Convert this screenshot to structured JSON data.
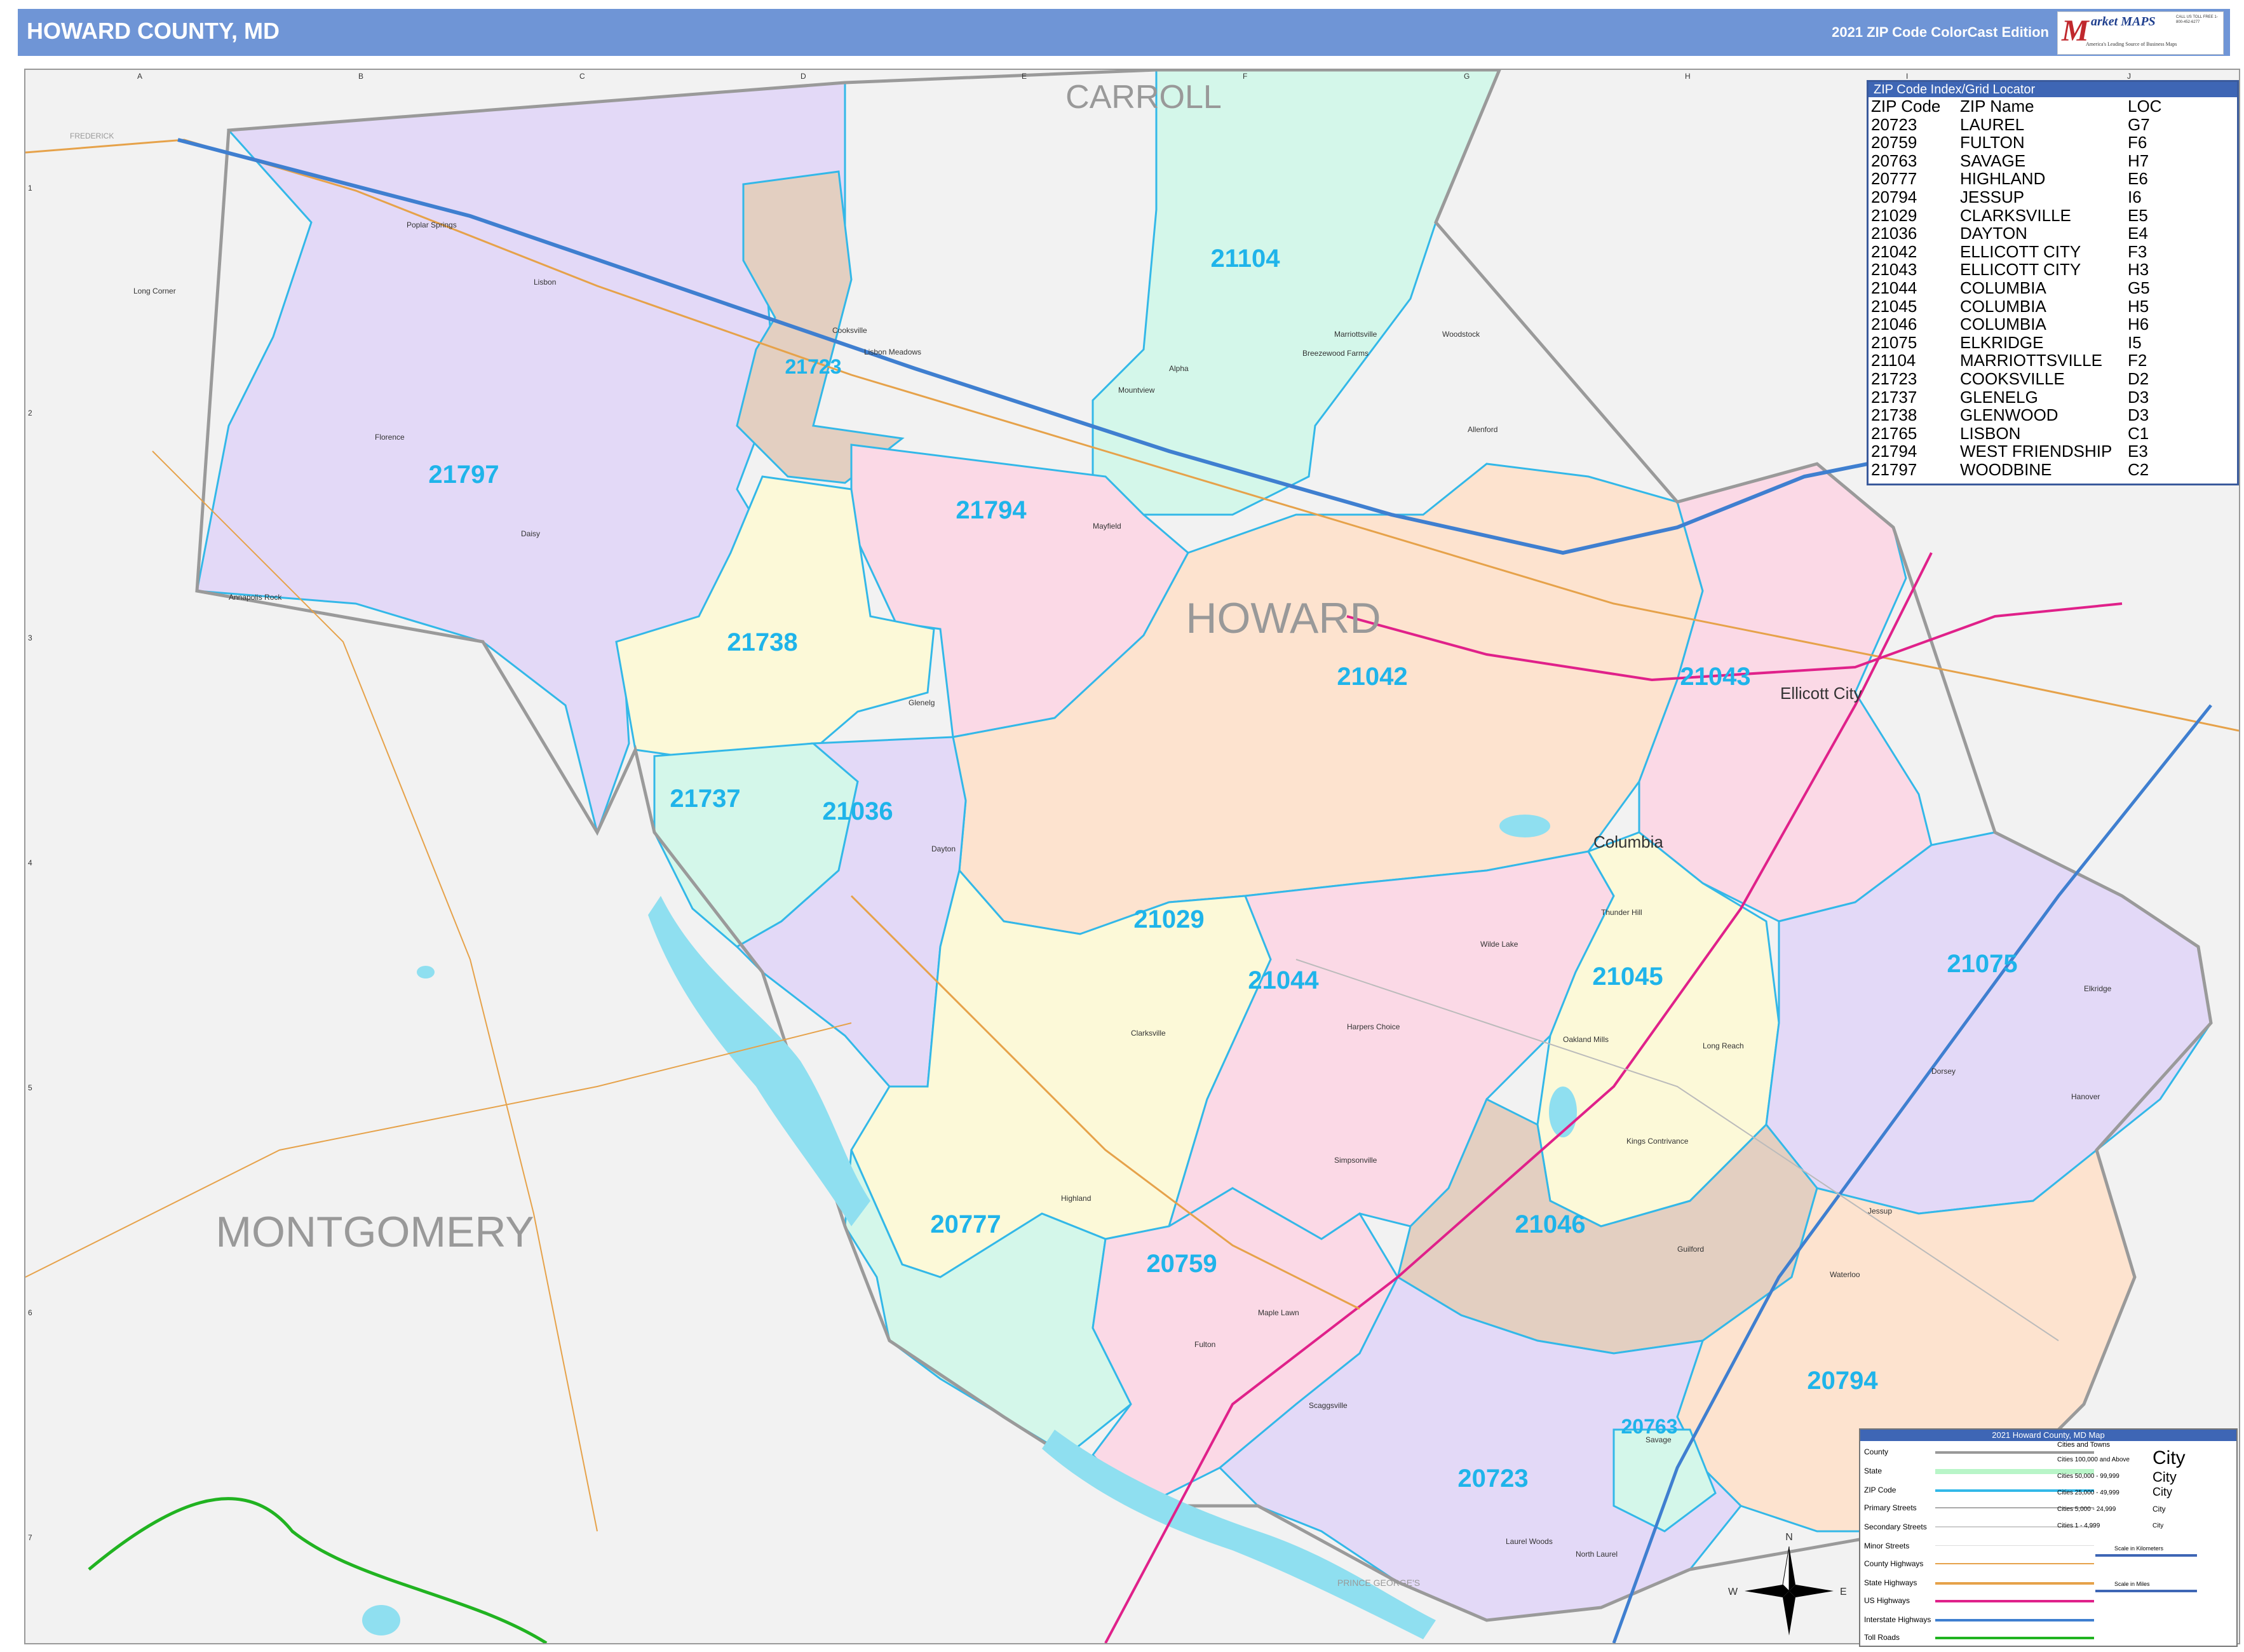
{
  "header": {
    "title": "HOWARD COUNTY, MD",
    "edition": "2021 ZIP Code ColorCast Edition",
    "logo_m": "M",
    "logo_name": "arket MAPS",
    "logo_tagline": "America's Leading Source of Business Maps",
    "logo_contact": "CALL US TOLL FREE 1-800-452-6277"
  },
  "counties": {
    "carroll": "CARROLL",
    "howard": "HOWARD",
    "montgomery": "MONTGOMERY",
    "prince_georges": "PRINCE GEORGE'S",
    "frederick": "FREDERICK"
  },
  "cities": {
    "ellicott_city": "Ellicott City",
    "columbia": "Columbia"
  },
  "zip_labels": [
    "21104",
    "21723",
    "21797",
    "21794",
    "21738",
    "21042",
    "21043",
    "21737",
    "21036",
    "21029",
    "21044",
    "21045",
    "21075",
    "21046",
    "20777",
    "20759",
    "20794",
    "20763",
    "20723"
  ],
  "places": [
    "Poplar Springs",
    "Lisbon",
    "Long Corner",
    "Florence",
    "Daisy",
    "Annapolis Rock",
    "Cooksville",
    "Lisbon Meadows",
    "Alpha",
    "Mountview",
    "Marriottsville",
    "Woodstock",
    "Breezewood Farms",
    "Allenford",
    "Glenelg",
    "Dayton",
    "Clarksville",
    "Highland",
    "Fulton",
    "Scaggsville",
    "Savage",
    "Jessup",
    "Elkridge",
    "Dorsey",
    "Mayfield",
    "Guilford",
    "Simpsonville",
    "Waterloo",
    "Hanover",
    "North Laurel",
    "Laurel Woods",
    "Kings Contrivance",
    "Oakland Mills",
    "Harpers Choice",
    "Wilde Lake",
    "Long Reach",
    "Thunder Hill",
    "Maple Lawn"
  ],
  "index": {
    "title": "ZIP Code Index/Grid Locator",
    "headers": [
      "ZIP Code",
      "ZIP Name",
      "LOC"
    ],
    "rows": [
      [
        "20723",
        "LAUREL",
        "G7"
      ],
      [
        "20759",
        "FULTON",
        "F6"
      ],
      [
        "20763",
        "SAVAGE",
        "H7"
      ],
      [
        "20777",
        "HIGHLAND",
        "E6"
      ],
      [
        "20794",
        "JESSUP",
        "I6"
      ],
      [
        "21029",
        "CLARKSVILLE",
        "E5"
      ],
      [
        "21036",
        "DAYTON",
        "E4"
      ],
      [
        "21042",
        "ELLICOTT CITY",
        "F3"
      ],
      [
        "21043",
        "ELLICOTT CITY",
        "H3"
      ],
      [
        "21044",
        "COLUMBIA",
        "G5"
      ],
      [
        "21045",
        "COLUMBIA",
        "H5"
      ],
      [
        "21046",
        "COLUMBIA",
        "H6"
      ],
      [
        "21075",
        "ELKRIDGE",
        "I5"
      ],
      [
        "21104",
        "MARRIOTTSVILLE",
        "F2"
      ],
      [
        "21723",
        "COOKSVILLE",
        "D2"
      ],
      [
        "21737",
        "GLENELG",
        "D3"
      ],
      [
        "21738",
        "GLENWOOD",
        "D3"
      ],
      [
        "21765",
        "LISBON",
        "C1"
      ],
      [
        "21794",
        "WEST FRIENDSHIP",
        "E3"
      ],
      [
        "21797",
        "WOODBINE",
        "C2"
      ]
    ]
  },
  "legend": {
    "title": "2021 Howard County, MD Map",
    "items": [
      "County",
      "State",
      "ZIP Code",
      "Primary Streets",
      "Secondary Streets",
      "Minor Streets",
      "County Highways",
      "State Highways",
      "US Highways",
      "Interstate Highways",
      "Toll Roads"
    ],
    "cities_title": "Cities and Towns",
    "city_classes": [
      "Cities 100,000 and Above",
      "Cities 50,000 - 99,999",
      "Cities 25,000 - 49,999",
      "Cities 5,000 - 24,999",
      "Cities 1 - 4,999"
    ],
    "city_samples": [
      "City",
      "City",
      "City",
      "City",
      "City"
    ],
    "scale_km": "Scale in Kilometers",
    "scale_mi": "Scale in Miles"
  },
  "compass": {
    "n": "N",
    "s": "S",
    "e": "E",
    "w": "W"
  },
  "grid": {
    "cols": [
      "A",
      "B",
      "C",
      "D",
      "E",
      "F",
      "G",
      "H",
      "I",
      "J"
    ],
    "rows": [
      "1",
      "2",
      "3",
      "4",
      "5",
      "6",
      "7"
    ]
  },
  "colors": {
    "header": "#6f95d6",
    "zip_text": "#1fb4ea",
    "water": "#8fdff0",
    "interstate": "#3f7fd0",
    "us_highway": "#e0218a",
    "state_highway": "#e6a24a",
    "toll": "#21b321"
  }
}
